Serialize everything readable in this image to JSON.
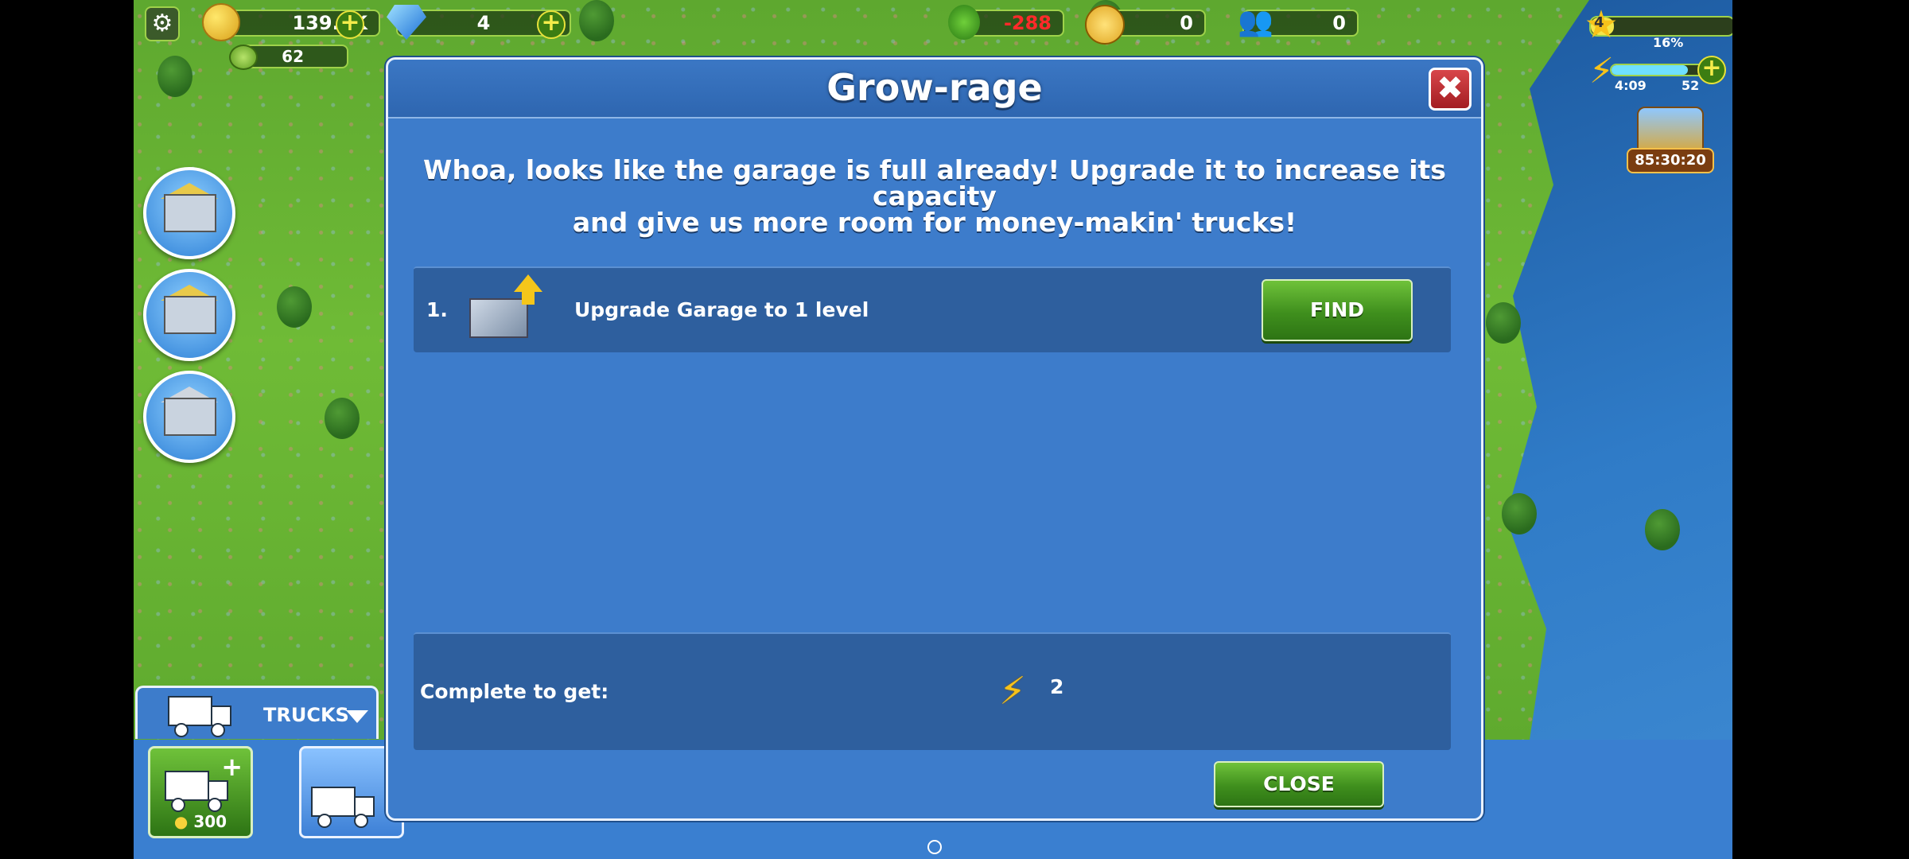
{
  "hud": {
    "coins": "139.9K",
    "gems": "4",
    "cash": "62",
    "eco": "-288",
    "happiness": "0",
    "population": "0",
    "level": "4",
    "xp_percent": "16%",
    "energy_timer": "4:09",
    "energy": "52",
    "chest_timer": "85:30:20"
  },
  "dialog": {
    "title": "Grow-rage",
    "message": "Whoa, looks like the garage is full already! Upgrade it to increase its capacity\nand give us more room for money-makin' trucks!",
    "tasks": [
      {
        "number": "1.",
        "label": "Upgrade Garage to 1 level",
        "button": "FIND"
      }
    ],
    "reward_label": "Complete to get:",
    "reward_value": "2",
    "close_button": "CLOSE"
  },
  "bottom_panel": {
    "tab_label": "TRUCKS",
    "buy_price": "300"
  },
  "icons": [
    "gear-icon",
    "coin-icon",
    "gem-icon",
    "cash-icon",
    "tree-icon",
    "smiley-icon",
    "people-icon",
    "star-icon",
    "lightning-icon",
    "chest-icon",
    "close-icon",
    "lightning-reward-icon",
    "truck-icon",
    "chevron-down-icon"
  ],
  "colors": {
    "dialog_bg": "#3d7ccb",
    "panel_bg": "#2e5f9e",
    "button_green": "#3f8f1d",
    "close_red": "#c0282d",
    "eco_negative": "#ff2a2a",
    "bolt_yellow": "#f7c21a"
  }
}
